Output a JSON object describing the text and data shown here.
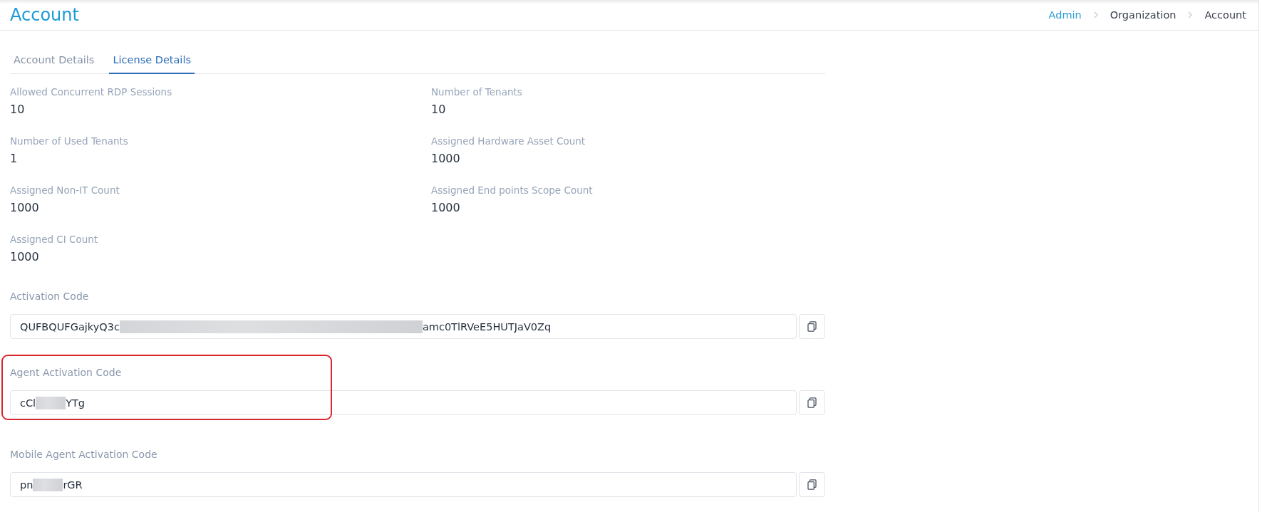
{
  "header": {
    "title": "Account",
    "breadcrumb": [
      {
        "label": "Admin",
        "kind": "link"
      },
      {
        "label": "Organization",
        "kind": "text"
      },
      {
        "label": "Account",
        "kind": "text"
      }
    ]
  },
  "tabs": [
    {
      "label": "Account Details",
      "selected": false
    },
    {
      "label": "License Details",
      "selected": true
    }
  ],
  "details": [
    {
      "label": "Allowed Concurrent RDP Sessions",
      "value": "10"
    },
    {
      "label": "Number of Tenants",
      "value": "10"
    },
    {
      "label": "Number of Used Tenants",
      "value": "1"
    },
    {
      "label": "Assigned Hardware Asset Count",
      "value": "1000"
    },
    {
      "label": "Assigned Non-IT Count",
      "value": "1000"
    },
    {
      "label": "Assigned End points Scope Count",
      "value": "1000"
    },
    {
      "label": "Assigned CI Count",
      "value": "1000"
    }
  ],
  "codes": [
    {
      "label": "Activation Code",
      "value_start": "QUFBQUFGajkyQ3c",
      "value_end": "amc0TlRVeE5HUTJaV0Zq",
      "kind": "wide",
      "highlighted": false
    },
    {
      "label": "Agent Activation Code",
      "value_start": "cCl",
      "value_end": "YTg",
      "kind": "narrow",
      "highlighted": true
    },
    {
      "label": "Mobile Agent Activation Code",
      "value_start": "pn",
      "value_end": "rGR",
      "kind": "narrow",
      "highlighted": false
    }
  ]
}
